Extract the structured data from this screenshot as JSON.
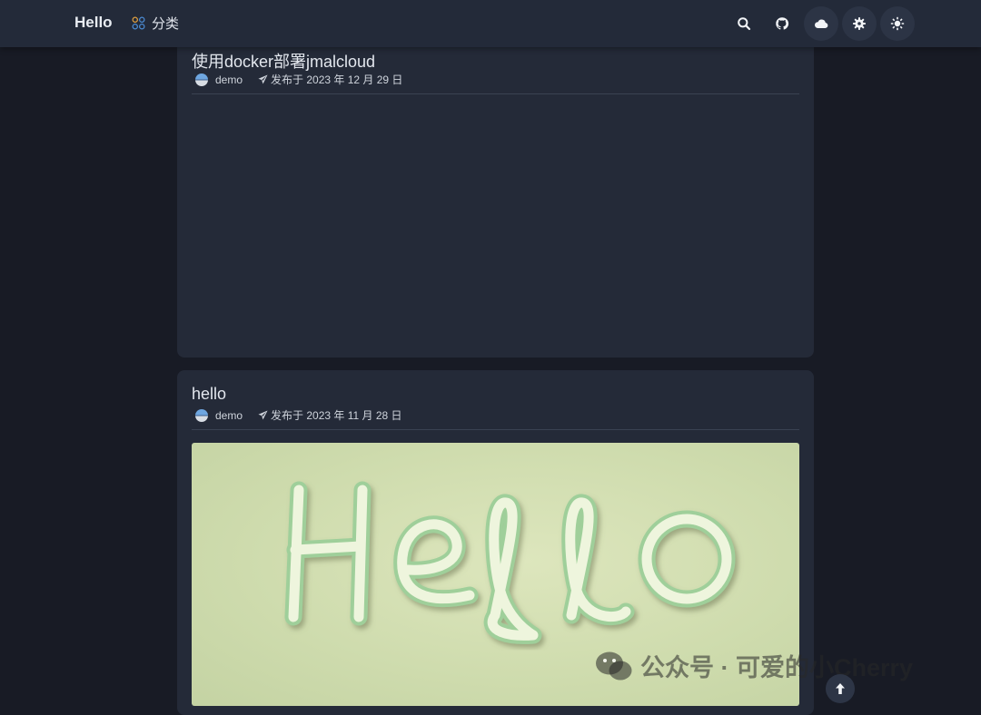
{
  "header": {
    "brand": "Hello",
    "nav_category": "分类",
    "icons": [
      "search-icon",
      "github-icon",
      "cloud-icon",
      "gear-icon",
      "theme-icon"
    ]
  },
  "posts": [
    {
      "title": "使用docker部署jmalcloud",
      "author": "demo",
      "date": "发布于 2023 年 12 月 29 日"
    },
    {
      "title": "hello",
      "author": "demo",
      "date": "发布于 2023 年 11 月 28 日",
      "cover_text": "Hello"
    }
  ],
  "watermark": {
    "text": "公众号 · 可爱的小Cherry"
  },
  "colors": {
    "background": "#181b25",
    "topbar": "#232a39",
    "card": "#242a38",
    "accent": "#4c8dd6",
    "cover": "#cfdcae"
  }
}
